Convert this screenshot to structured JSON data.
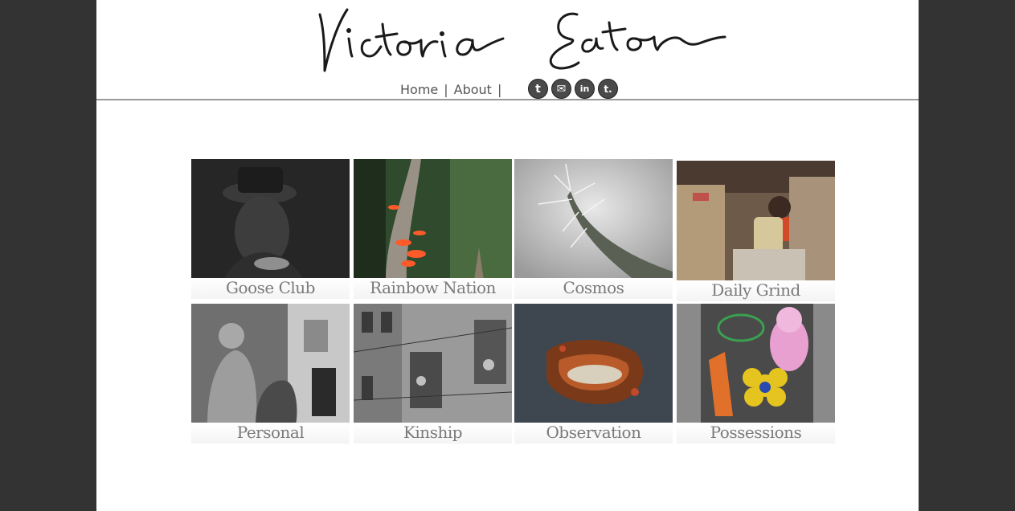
{
  "header": {
    "signature_text": "Victoria Eaton"
  },
  "nav": {
    "items": [
      {
        "label": "Home"
      },
      {
        "label": "About"
      }
    ],
    "separator": "|"
  },
  "social": [
    {
      "name": "twitter-icon",
      "glyph": "t"
    },
    {
      "name": "email-icon",
      "glyph": "✉"
    },
    {
      "name": "linkedin-icon",
      "glyph": "in"
    },
    {
      "name": "tumblr-icon",
      "glyph": "t."
    }
  ],
  "gallery": [
    {
      "caption": "Goose Club"
    },
    {
      "caption": "Rainbow Nation"
    },
    {
      "caption": "Cosmos"
    },
    {
      "caption": "Daily Grind"
    },
    {
      "caption": "Personal"
    },
    {
      "caption": "Kinship"
    },
    {
      "caption": "Observation"
    },
    {
      "caption": "Possessions"
    }
  ],
  "colors": {
    "outer_background": "#333333",
    "page_background": "#ffffff",
    "caption_text": "#7a7a7a",
    "nav_text": "#555555"
  }
}
